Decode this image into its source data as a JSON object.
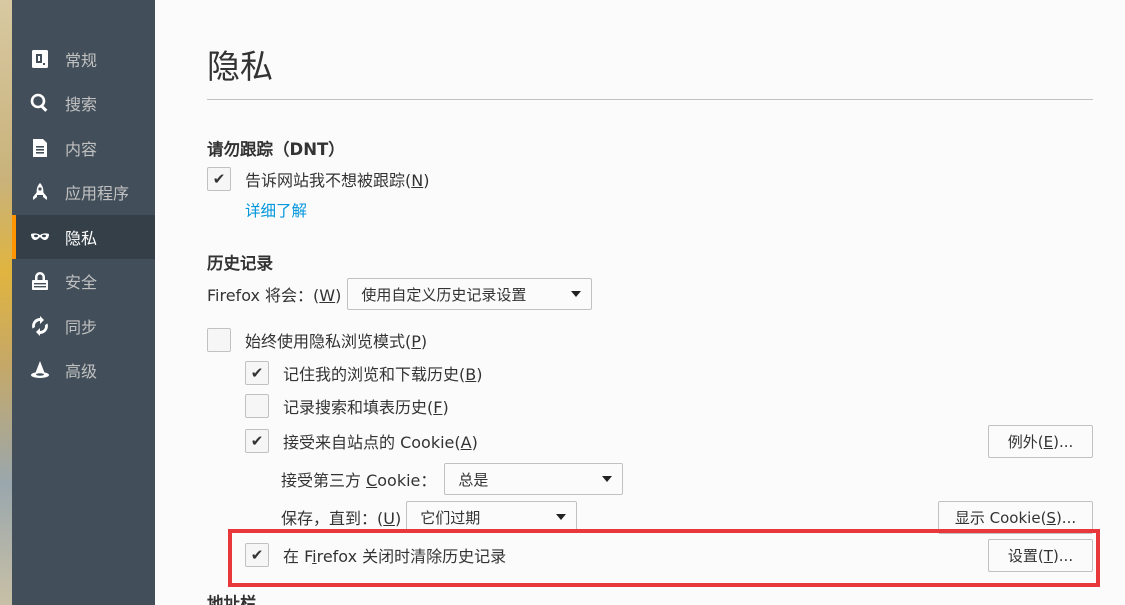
{
  "sidebar": {
    "items": [
      {
        "label": "常规",
        "icon": "general-icon"
      },
      {
        "label": "搜索",
        "icon": "search-icon"
      },
      {
        "label": "内容",
        "icon": "content-icon"
      },
      {
        "label": "应用程序",
        "icon": "rocket-icon"
      },
      {
        "label": "隐私",
        "icon": "mask-icon",
        "selected": true
      },
      {
        "label": "安全",
        "icon": "lock-icon"
      },
      {
        "label": "同步",
        "icon": "sync-icon"
      },
      {
        "label": "高级",
        "icon": "wizard-hat-icon"
      }
    ]
  },
  "page": {
    "title": "隐私"
  },
  "dnt": {
    "title": "请勿跟踪（DNT）",
    "checkbox_label_pre": "告诉网站我不想被跟踪(",
    "checkbox_key": "N",
    "checkbox_label_post": ")",
    "checked": true,
    "learn_more": "详细了解"
  },
  "history": {
    "title": "历史记录",
    "firefox_will_pre": "Firefox 将会：(",
    "firefox_will_key": "W",
    "firefox_will_post": ")",
    "mode_select": "使用自定义历史记录设置",
    "always_private": {
      "pre": "始终使用隐私浏览模式(",
      "key": "P",
      "post": ")",
      "checked": false
    },
    "remember_browsing": {
      "pre": "记住我的浏览和下载历史(",
      "key": "B",
      "post": ")",
      "checked": true
    },
    "remember_search": {
      "pre": "记录搜索和填表历史(",
      "key": "F",
      "post": ")",
      "checked": false
    },
    "accept_cookies": {
      "pre": "接受来自站点的 Cookie(",
      "key": "A",
      "post": ")",
      "checked": true
    },
    "exceptions_button": {
      "pre": "例外(",
      "key": "E",
      "post": ")..."
    },
    "third_party": {
      "pre": "接受第三方 ",
      "key": "C",
      "post": "ookie：",
      "value": "总是"
    },
    "keep_until": {
      "pre": "保存，直到：(",
      "key": "U",
      "post": ")",
      "value": "它们过期"
    },
    "show_cookies_button": {
      "pre": "显示 Cookie(",
      "key": "S",
      "post": ")..."
    },
    "clear_on_close": {
      "pre": "在 F",
      "key": "i",
      "post": "refox 关闭时清除历史记录",
      "checked": true
    },
    "settings_button": {
      "pre": "设置(",
      "key": "T",
      "post": ")..."
    }
  },
  "next_section": {
    "title": "地址栏"
  },
  "colors": {
    "sidebar": "#424f5a",
    "sidebar_selected": "#343f48",
    "accent": "#ff9500",
    "link": "#0096dc",
    "highlight": "#e8383c"
  }
}
